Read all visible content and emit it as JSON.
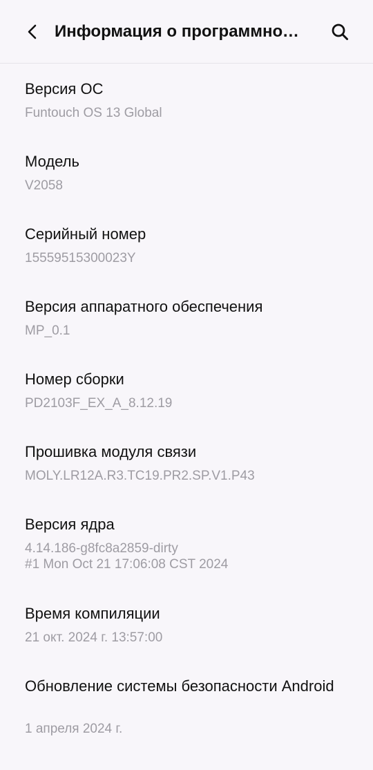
{
  "header": {
    "title": "Информация о программном обеспечении",
    "back_icon": "chevron-left-icon",
    "search_icon": "search-icon"
  },
  "items": [
    {
      "title": "Версия ОС",
      "value": "Funtouch OS 13 Global"
    },
    {
      "title": "Модель",
      "value": "V2058"
    },
    {
      "title": "Серийный номер",
      "value": "15559515300023Y"
    },
    {
      "title": "Версия аппаратного обеспечения",
      "value": "MP_0.1"
    },
    {
      "title": "Номер сборки",
      "value": "PD2103F_EX_A_8.12.19"
    },
    {
      "title": "Прошивка модуля связи",
      "value": "MOLY.LR12A.R3.TC19.PR2.SP.V1.P43"
    },
    {
      "title": "Версия ядра",
      "value": "4.14.186-g8fc8a2859-dirty\n#1 Mon Oct 21 17:06:08 CST 2024"
    },
    {
      "title": "Время компиляции",
      "value": "21 окт. 2024 г. 13:57:00"
    },
    {
      "title": "Обновление системы безопасности Android",
      "value": "1 апреля 2024 г."
    }
  ]
}
